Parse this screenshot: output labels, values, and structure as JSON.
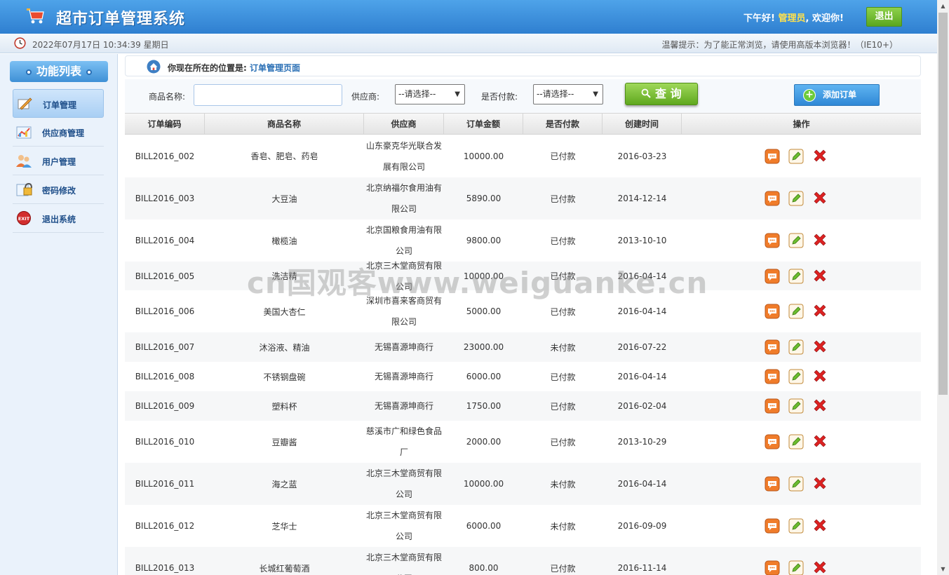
{
  "header": {
    "title": "超市订单管理系统",
    "greeting_prefix": "下午好!",
    "role": "管理员",
    "greeting_suffix": ", 欢迎你!",
    "logout_label": "退出"
  },
  "statusbar": {
    "datetime": "2022年07月17日 10:34:39 星期日",
    "tip": "温馨提示：为了能正常浏览，请使用高版本浏览器！（IE10+）"
  },
  "sidebar": {
    "title": "功能列表",
    "items": [
      {
        "label": "订单管理",
        "icon": "pen-paper-icon"
      },
      {
        "label": "供应商管理",
        "icon": "chart-icon"
      },
      {
        "label": "用户管理",
        "icon": "users-icon"
      },
      {
        "label": "密码修改",
        "icon": "lock-icon"
      },
      {
        "label": "退出系统",
        "icon": "exit-icon"
      }
    ]
  },
  "breadcrumb": {
    "prefix": "你现在所在的位置是:",
    "page": "订单管理页面"
  },
  "search": {
    "product_label": "商品名称:",
    "product_value": "",
    "provider_label": "供应商:",
    "provider_selected": "--请选择--",
    "paid_label": "是否付款:",
    "paid_selected": "--请选择--",
    "query_label": "查 询",
    "add_label": "添加订单"
  },
  "table": {
    "headers": [
      "订单编码",
      "商品名称",
      "供应商",
      "订单金额",
      "是否付款",
      "创建时间",
      "操作"
    ],
    "rows": [
      {
        "code": "BILL2016_002",
        "product": "香皂、肥皂、药皂",
        "provider": "山东豪克华光联合发展有限公司",
        "amount": "10000.00",
        "paid": "已付款",
        "date": "2016-03-23"
      },
      {
        "code": "BILL2016_003",
        "product": "大豆油",
        "provider": "北京纳福尔食用油有限公司",
        "amount": "5890.00",
        "paid": "已付款",
        "date": "2014-12-14"
      },
      {
        "code": "BILL2016_004",
        "product": "橄榄油",
        "provider": "北京国粮食用油有限公司",
        "amount": "9800.00",
        "paid": "已付款",
        "date": "2013-10-10"
      },
      {
        "code": "BILL2016_005",
        "product": "洗洁精",
        "provider": "北京三木堂商贸有限公司",
        "amount": "10000.00",
        "paid": "已付款",
        "date": "2016-04-14"
      },
      {
        "code": "BILL2016_006",
        "product": "美国大杏仁",
        "provider": "深圳市喜来客商贸有限公司",
        "amount": "5000.00",
        "paid": "已付款",
        "date": "2016-04-14"
      },
      {
        "code": "BILL2016_007",
        "product": "沐浴液、精油",
        "provider": "无锡喜源坤商行",
        "amount": "23000.00",
        "paid": "未付款",
        "date": "2016-07-22"
      },
      {
        "code": "BILL2016_008",
        "product": "不锈钢盘碗",
        "provider": "无锡喜源坤商行",
        "amount": "6000.00",
        "paid": "已付款",
        "date": "2016-04-14"
      },
      {
        "code": "BILL2016_009",
        "product": "塑料杯",
        "provider": "无锡喜源坤商行",
        "amount": "1750.00",
        "paid": "已付款",
        "date": "2016-02-04"
      },
      {
        "code": "BILL2016_010",
        "product": "豆瓣酱",
        "provider": "慈溪市广和绿色食品厂",
        "amount": "2000.00",
        "paid": "已付款",
        "date": "2013-10-29"
      },
      {
        "code": "BILL2016_011",
        "product": "海之蓝",
        "provider": "北京三木堂商贸有限公司",
        "amount": "10000.00",
        "paid": "未付款",
        "date": "2016-04-14"
      },
      {
        "code": "BILL2016_012",
        "product": "芝华士",
        "provider": "北京三木堂商贸有限公司",
        "amount": "6000.00",
        "paid": "未付款",
        "date": "2016-09-09"
      },
      {
        "code": "BILL2016_013",
        "product": "长城红葡萄酒",
        "provider": "北京三木堂商贸有限公司",
        "amount": "800.00",
        "paid": "已付款",
        "date": "2016-11-14"
      }
    ]
  },
  "watermark": "cn国观客www.weiguanke.cn",
  "colors": {
    "header": "#3a8fdc",
    "accent_green": "#6cbd2f",
    "link_blue": "#2a6fb5"
  }
}
